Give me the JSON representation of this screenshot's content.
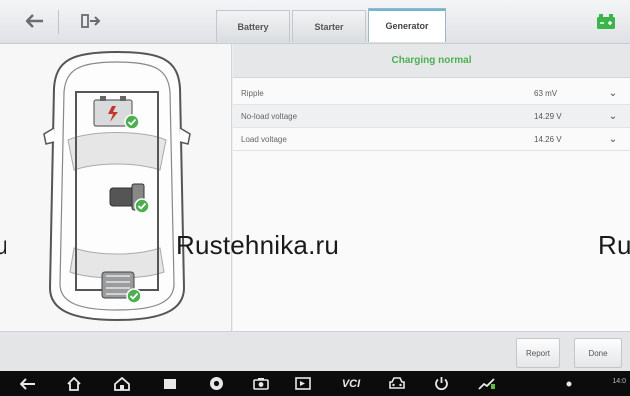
{
  "toolbar": {
    "back_icon": "back-arrow-icon",
    "exit_icon": "exit-icon",
    "tabs": [
      {
        "label": "Battery",
        "active": false
      },
      {
        "label": "Starter",
        "active": false
      },
      {
        "label": "Generator",
        "active": true
      }
    ],
    "battery_status_icon": "vehicle-battery-icon",
    "battery_status_color": "#3bb54a"
  },
  "diagram": {
    "components": [
      {
        "name": "battery",
        "status": "ok"
      },
      {
        "name": "starter",
        "status": "ok"
      },
      {
        "name": "generator",
        "status": "ok"
      }
    ],
    "ok_color": "#4caf50"
  },
  "status": {
    "text": "Charging normal",
    "color": "#4caf50"
  },
  "parameters": [
    {
      "name": "Ripple",
      "value": "63 mV"
    },
    {
      "name": "No-load voltage",
      "value": "14.29 V"
    },
    {
      "name": "Load voltage",
      "value": "14.26 V"
    }
  ],
  "watermark": {
    "left": "u",
    "center": "Rustehnika.ru",
    "right": "Ru"
  },
  "actions": {
    "report_label": "Report",
    "done_label": "Done"
  },
  "system_bar": {
    "icons": [
      "back-icon",
      "home-icon",
      "house-icon",
      "recent-apps-icon",
      "chrome-icon",
      "camera-icon",
      "screen-record-icon",
      "vci-icon",
      "car-icon",
      "power-icon",
      "network-icon"
    ],
    "vci_label": "VCI",
    "status_text": "14:0"
  }
}
